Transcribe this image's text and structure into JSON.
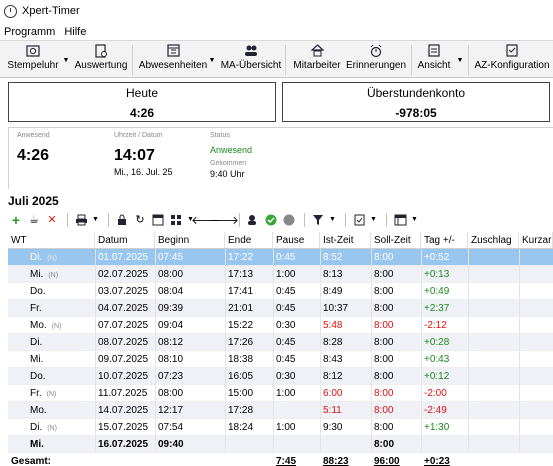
{
  "window": {
    "title": "Xpert-Timer"
  },
  "menu": [
    "Programm",
    "Hilfe"
  ],
  "ribbon": {
    "items": [
      {
        "label": "Stempeluhr",
        "icon": "clock-icon"
      },
      {
        "label": "Auswertung",
        "icon": "report-icon"
      },
      {
        "label": "Abwesenheiten",
        "icon": "calendar-icon"
      },
      {
        "label": "MA-Übersicht",
        "icon": "people-icon"
      },
      {
        "label": "Mitarbeiter",
        "icon": "employee-icon"
      },
      {
        "label": "Erinnerungen",
        "icon": "alarm-icon"
      },
      {
        "label": "Ansicht",
        "icon": "view-icon"
      },
      {
        "label": "AZ-Konfiguration",
        "icon": "config-icon"
      }
    ]
  },
  "panels": {
    "heute": {
      "label": "Heute",
      "value": "4:26"
    },
    "konto": {
      "label": "Überstundenkonto",
      "value": "-978:05"
    }
  },
  "status": {
    "anwesend_label": "Anwesend",
    "anwesend_value": "4:26",
    "uhrzeit_label": "Uhrzeit / Datum",
    "uhrzeit_value": "14:07",
    "datum_value": "Mi., 16. Jul. 25",
    "status_label": "Status",
    "status_value": "Anwesend",
    "gekommen_label": "Gekommen",
    "gekommen_value": "9:40 Uhr"
  },
  "month": "Juli 2025",
  "table": {
    "headers": [
      "WT",
      "Datum",
      "Beginn",
      "Ende",
      "Pause",
      "Ist-Zeit",
      "Soll-Zeit",
      "Tag +/-",
      "Zuschlag",
      "Kurzarb"
    ],
    "rows": [
      {
        "wt": "Di.",
        "n": "(N)",
        "datum": "01.07.2025",
        "beginn": "07:45",
        "ende": "17:22",
        "pause": "0:45",
        "ist": "8:52",
        "soll": "8:00",
        "tag": "+0:52",
        "sel": true
      },
      {
        "wt": "Mi.",
        "n": "(N)",
        "datum": "02.07.2025",
        "beginn": "08:00",
        "ende": "17:13",
        "pause": "1:00",
        "ist": "8:13",
        "soll": "8:00",
        "tag": "+0:13"
      },
      {
        "wt": "Do.",
        "n": "",
        "datum": "03.07.2025",
        "beginn": "08:04",
        "ende": "17:41",
        "pause": "0:45",
        "ist": "8:49",
        "soll": "8:00",
        "tag": "+0:49"
      },
      {
        "wt": "Fr.",
        "n": "",
        "datum": "04.07.2025",
        "beginn": "09:39",
        "ende": "21:01",
        "pause": "0:45",
        "ist": "10:37",
        "soll": "8:00",
        "tag": "+2:37"
      },
      {
        "wt": "Mo.",
        "n": "(N)",
        "datum": "07.07.2025",
        "beginn": "09:04",
        "ende": "15:22",
        "pause": "0:30",
        "ist": "5:48",
        "soll": "8:00",
        "tag": "-2:12",
        "neg": true
      },
      {
        "wt": "Di.",
        "n": "",
        "datum": "08.07.2025",
        "beginn": "08:12",
        "ende": "17:26",
        "pause": "0:45",
        "ist": "8:28",
        "soll": "8:00",
        "tag": "+0:28"
      },
      {
        "wt": "Mi.",
        "n": "",
        "datum": "09.07.2025",
        "beginn": "08:10",
        "ende": "18:38",
        "pause": "0:45",
        "ist": "8:43",
        "soll": "8:00",
        "tag": "+0:43"
      },
      {
        "wt": "Do.",
        "n": "",
        "datum": "10.07.2025",
        "beginn": "07:23",
        "ende": "16:05",
        "pause": "0:30",
        "ist": "8:12",
        "soll": "8:00",
        "tag": "+0:12"
      },
      {
        "wt": "Fr.",
        "n": "(N)",
        "datum": "11.07.2025",
        "beginn": "08:00",
        "ende": "15:00",
        "pause": "1:00",
        "ist": "6:00",
        "soll": "8:00",
        "tag": "-2:00",
        "neg": true
      },
      {
        "wt": "Mo.",
        "n": "",
        "datum": "14.07.2025",
        "beginn": "12:17",
        "ende": "17:28",
        "pause": "",
        "ist": "5:11",
        "soll": "8:00",
        "tag": "-2:49",
        "neg": true
      },
      {
        "wt": "Di.",
        "n": "(N)",
        "datum": "15.07.2025",
        "beginn": "07:54",
        "ende": "18:24",
        "pause": "1:00",
        "ist": "9:30",
        "soll": "8:00",
        "tag": "+1:30"
      },
      {
        "wt": "Mi.",
        "n": "",
        "datum": "16.07.2025",
        "beginn": "09:40",
        "ende": "",
        "pause": "",
        "ist": "",
        "soll": "8:00",
        "tag": "",
        "bold": true
      }
    ],
    "total": {
      "label": "Gesamt:",
      "pause": "7:45",
      "ist": "88:23",
      "soll": "96:00",
      "tag": "+0:23"
    }
  }
}
